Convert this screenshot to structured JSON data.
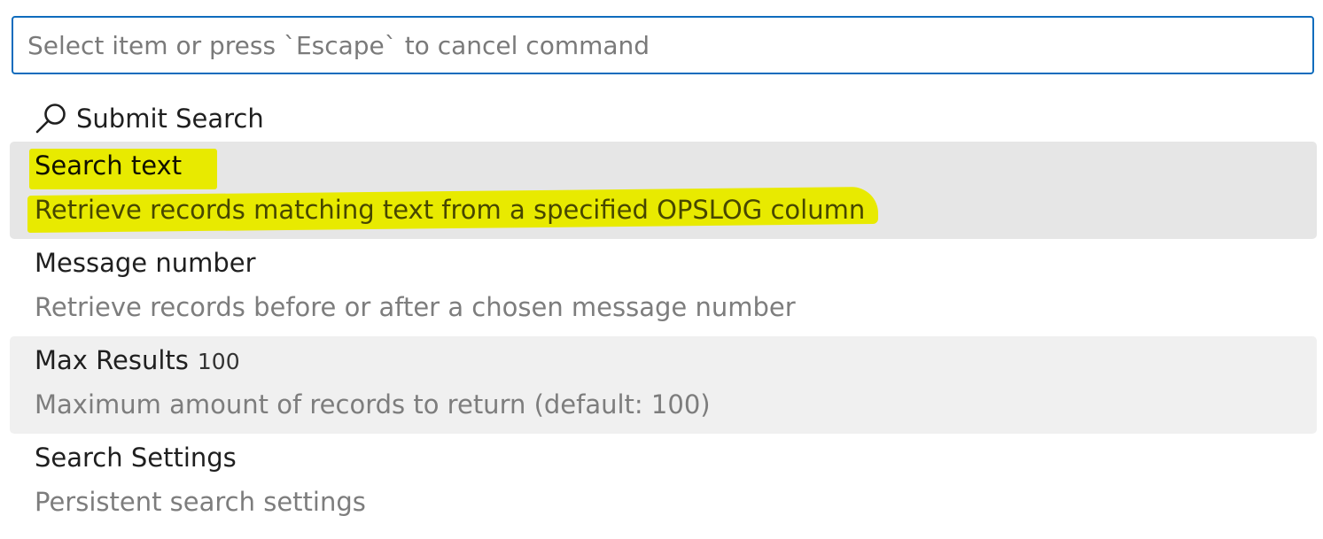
{
  "quick_pick": {
    "input": {
      "placeholder": "Select item or press `Escape` to cancel command",
      "value": ""
    },
    "submit": {
      "icon": "search-icon",
      "label": "Submit Search"
    },
    "items": [
      {
        "title": "Search text",
        "value": "",
        "description": "Retrieve records matching text from a specified OPSLOG column",
        "state": "active",
        "highlighted": true
      },
      {
        "title": "Message number",
        "value": "",
        "description": "Retrieve records before or after a chosen message number",
        "state": "normal",
        "highlighted": false
      },
      {
        "title": "Max Results",
        "value": "100",
        "description": "Maximum amount of records to return (default: 100)",
        "state": "hover",
        "highlighted": false
      },
      {
        "title": "Search Settings",
        "value": "",
        "description": "Persistent search settings",
        "state": "normal",
        "highlighted": false
      }
    ],
    "colors": {
      "focus_border": "#0f6cbd",
      "active_bg": "#e6e6e6",
      "hover_bg": "#f0f0f0",
      "highlight": "#e8ea00"
    }
  }
}
